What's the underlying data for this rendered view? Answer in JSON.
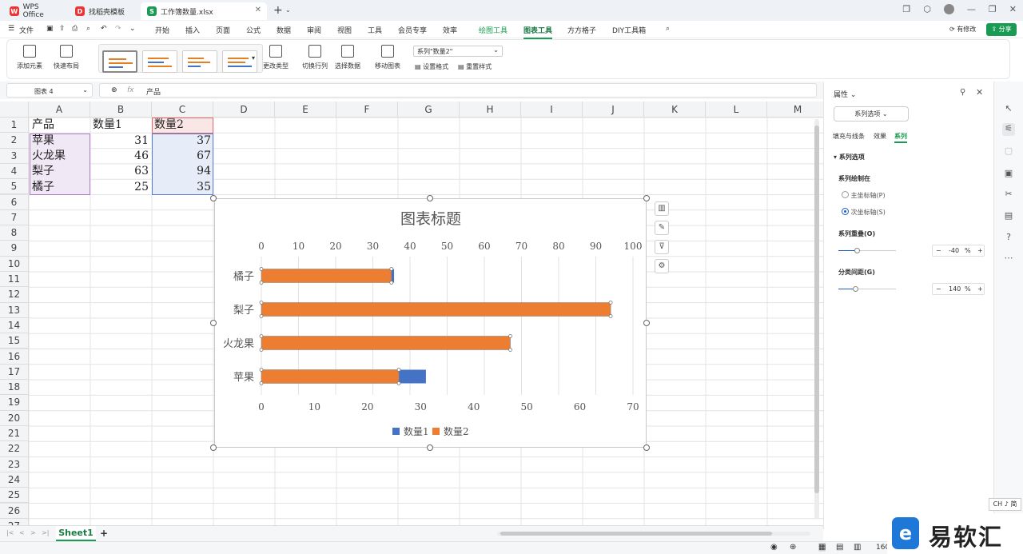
{
  "tabs": [
    {
      "label": "WPS Office",
      "icon": "wps-logo-icon"
    },
    {
      "label": "找稻壳模板",
      "icon": "docer-icon"
    },
    {
      "label": "工作簿数量.xlsx",
      "icon": "spreadsheet-icon"
    }
  ],
  "menu": {
    "file": "文件",
    "items": [
      "开始",
      "插入",
      "页面",
      "公式",
      "数据",
      "审阅",
      "视图",
      "工具",
      "会员专享",
      "效率",
      "绘图工具",
      "图表工具",
      "方方格子",
      "DIY工具箱"
    ],
    "active": "图表工具",
    "edit_status": "有修改",
    "share": "分享"
  },
  "ribbon": {
    "add_element": "添加元素",
    "quick_layout": "快速布局",
    "change_type": "更改类型",
    "switch_rowcol": "切换行列",
    "select_data": "选择数据",
    "move_chart": "移动图表",
    "series_select": "系列\"数量2\"",
    "set_format": "设置格式",
    "reset_style": "重置样式"
  },
  "formula_bar": {
    "name_box": "图表 4",
    "fx": "fx",
    "content": "产品"
  },
  "columns": [
    "A",
    "B",
    "C",
    "D",
    "E",
    "F",
    "G",
    "H",
    "I",
    "J",
    "K",
    "L",
    "M"
  ],
  "rows": [
    "1",
    "2",
    "3",
    "4",
    "5",
    "6",
    "7",
    "8",
    "9",
    "10",
    "11",
    "12",
    "13",
    "14",
    "15",
    "16",
    "17",
    "18",
    "19",
    "20",
    "21",
    "22",
    "23",
    "24",
    "25",
    "26",
    "27"
  ],
  "sheet_table": {
    "headers": [
      "产品",
      "数量1",
      "数量2"
    ],
    "rows": [
      [
        "苹果",
        "31",
        "37"
      ],
      [
        "火龙果",
        "46",
        "67"
      ],
      [
        "梨子",
        "63",
        "94"
      ],
      [
        "橘子",
        "25",
        "35"
      ]
    ]
  },
  "chart_data": {
    "type": "bar",
    "title": "图表标题",
    "categories": [
      "苹果",
      "火龙果",
      "梨子",
      "橘子"
    ],
    "series": [
      {
        "name": "数量1",
        "values": [
          31,
          46,
          63,
          25
        ],
        "color": "#4472c4",
        "axis": "primary"
      },
      {
        "name": "数量2",
        "values": [
          37,
          67,
          94,
          35
        ],
        "color": "#ed7d31",
        "axis": "secondary"
      }
    ],
    "primary_axis": {
      "range": [
        0,
        70
      ],
      "ticks": [
        "0",
        "10",
        "20",
        "30",
        "40",
        "50",
        "60",
        "70"
      ],
      "position": "bottom"
    },
    "secondary_axis": {
      "range": [
        0,
        100
      ],
      "ticks": [
        "0",
        "10",
        "20",
        "30",
        "40",
        "50",
        "60",
        "70",
        "80",
        "90",
        "100"
      ],
      "position": "top"
    },
    "grid": true,
    "legend": "bottom"
  },
  "panel": {
    "title": "属性",
    "dropdown": "系列选项",
    "tabs": [
      "填充与线条",
      "效果",
      "系列"
    ],
    "active_tab": "系列",
    "section": "系列选项",
    "plot_on": "系列绘制在",
    "primary": "主坐标轴(P)",
    "secondary": "次坐标轴(S)",
    "overlap_label": "系列重叠(O)",
    "overlap_value": "-40",
    "gap_label": "分类间距(G)",
    "gap_value": "140",
    "pct": "%"
  },
  "sheet": {
    "name": "Sheet1",
    "add": "+"
  },
  "status": {
    "zoom": "160",
    "ime": "CH ♪ 简"
  },
  "watermark": "易软汇"
}
